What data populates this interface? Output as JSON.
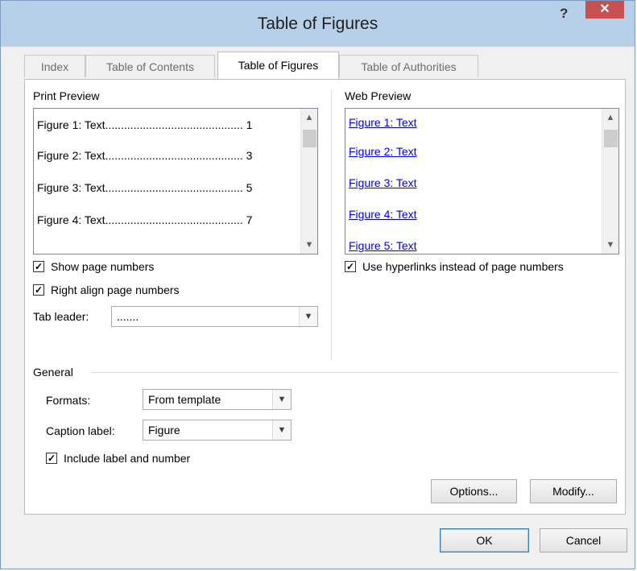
{
  "window": {
    "title": "Table of Figures",
    "help_label": "?",
    "close_label": "✕"
  },
  "tabs": [
    {
      "label": "Index"
    },
    {
      "label": "Table of Contents"
    },
    {
      "label": "Table of Figures"
    },
    {
      "label": "Table of Authorities"
    }
  ],
  "print_preview": {
    "heading": "Print Preview",
    "items": [
      "Figure 1: Text............................................ 1",
      "Figure 2: Text............................................ 3",
      "Figure 3: Text............................................ 5",
      "Figure 4: Text............................................ 7"
    ],
    "scroll_up_icon": "▲",
    "scroll_down_icon": "▼"
  },
  "options": {
    "show_page_numbers": "Show page numbers",
    "right_align": "Right align page numbers",
    "tab_leader_label": "Tab leader:",
    "tab_leader_value": "......."
  },
  "web_preview": {
    "heading": "Web Preview",
    "items": [
      "Figure 1: Text",
      "Figure 2: Text",
      "Figure 3: Text",
      "Figure 4: Text",
      "Figure 5: Text"
    ],
    "use_hyperlinks": "Use hyperlinks instead of page numbers"
  },
  "general": {
    "heading": "General",
    "formats_label": "Formats:",
    "formats_value": "From template",
    "caption_label": "Caption label:",
    "caption_value": "Figure",
    "include_label": "Include label and number"
  },
  "buttons": {
    "options": "Options...",
    "modify": "Modify...",
    "ok": "OK",
    "cancel": "Cancel"
  },
  "check_mark": "✓",
  "dropdown_arrow": "▼"
}
